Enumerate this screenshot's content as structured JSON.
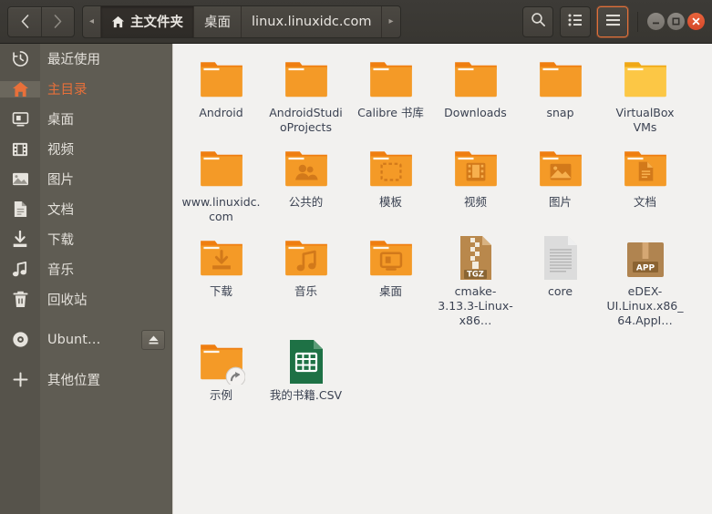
{
  "window": {
    "title": "主文件夹",
    "nav": {
      "back": "‹",
      "forward": "›"
    },
    "window_controls": {
      "minimize": "minimize",
      "maximize": "maximize",
      "close": "close"
    }
  },
  "pathbar": {
    "overflow_left": "◂",
    "overflow_right": "▸",
    "crumbs": [
      {
        "label": "主文件夹",
        "icon": "home-icon",
        "active": true
      },
      {
        "label": "桌面",
        "icon": "",
        "active": false
      },
      {
        "label": "linux.linuxidc.com",
        "icon": "",
        "active": false
      }
    ]
  },
  "toolbar": {
    "search_label": "search-icon",
    "list_view_label": "list-view-icon",
    "menu_label": "hamburger-menu-icon"
  },
  "sidebar": {
    "items": [
      {
        "label": "最近使用",
        "icon": "clock-icon",
        "selected": false,
        "gap": false,
        "eject": false
      },
      {
        "label": "主目录",
        "icon": "home-icon",
        "selected": true,
        "gap": false,
        "eject": false
      },
      {
        "label": "桌面",
        "icon": "desktop-icon",
        "selected": false,
        "gap": false,
        "eject": false
      },
      {
        "label": "视频",
        "icon": "film-icon",
        "selected": false,
        "gap": false,
        "eject": false
      },
      {
        "label": "图片",
        "icon": "image-icon",
        "selected": false,
        "gap": false,
        "eject": false
      },
      {
        "label": "文档",
        "icon": "document-icon",
        "selected": false,
        "gap": false,
        "eject": false
      },
      {
        "label": "下载",
        "icon": "download-icon",
        "selected": false,
        "gap": false,
        "eject": false
      },
      {
        "label": "音乐",
        "icon": "music-icon",
        "selected": false,
        "gap": false,
        "eject": false
      },
      {
        "label": "回收站",
        "icon": "trash-icon",
        "selected": false,
        "gap": false,
        "eject": false
      },
      {
        "label": "Ubunt…",
        "icon": "disc-icon",
        "selected": false,
        "gap": true,
        "eject": true
      },
      {
        "label": "其他位置",
        "icon": "plus-icon",
        "selected": false,
        "gap": true,
        "eject": false
      }
    ]
  },
  "files": [
    {
      "name": "Android",
      "type": "folder",
      "emblem": "none",
      "color": "#f49a27"
    },
    {
      "name": "AndroidStudioProjects",
      "type": "folder",
      "emblem": "none",
      "color": "#f49a27"
    },
    {
      "name": "Calibre 书库",
      "type": "folder",
      "emblem": "none",
      "color": "#f49a27"
    },
    {
      "name": "Downloads",
      "type": "folder",
      "emblem": "none",
      "color": "#f49a27"
    },
    {
      "name": "snap",
      "type": "folder",
      "emblem": "none",
      "color": "#f49a27"
    },
    {
      "name": "VirtualBox VMs",
      "type": "folder",
      "emblem": "none",
      "color": "#fcc745"
    },
    {
      "name": "www.linuxidc.com",
      "type": "folder",
      "emblem": "none",
      "color": "#f49a27"
    },
    {
      "name": "公共的",
      "type": "folder",
      "emblem": "people",
      "color": "#f49a27"
    },
    {
      "name": "模板",
      "type": "folder",
      "emblem": "template",
      "color": "#f49a27"
    },
    {
      "name": "视频",
      "type": "folder",
      "emblem": "film",
      "color": "#f49a27"
    },
    {
      "name": "图片",
      "type": "folder",
      "emblem": "image",
      "color": "#f49a27"
    },
    {
      "name": "文档",
      "type": "folder",
      "emblem": "document",
      "color": "#f49a27"
    },
    {
      "name": "下载",
      "type": "folder",
      "emblem": "download",
      "color": "#f49a27"
    },
    {
      "name": "音乐",
      "type": "folder",
      "emblem": "music",
      "color": "#f49a27"
    },
    {
      "name": "桌面",
      "type": "folder",
      "emblem": "desktop",
      "color": "#f49a27"
    },
    {
      "name": "cmake-3.13.3-Linux-x86…",
      "type": "archive",
      "emblem": "none",
      "badge": "TGZ",
      "color": "#a8763f"
    },
    {
      "name": "core",
      "type": "text",
      "emblem": "none",
      "color": "#d8d8d8"
    },
    {
      "name": "eDEX-UI.Linux.x86_64.AppI…",
      "type": "appimage",
      "emblem": "none",
      "badge": "APP",
      "color": "#a8763f"
    },
    {
      "name": "示例",
      "type": "folder",
      "emblem": "symlink",
      "color": "#f49a27"
    },
    {
      "name": "我的书籍.CSV",
      "type": "spreadsheet",
      "emblem": "none",
      "color": "#1e7145"
    }
  ]
}
